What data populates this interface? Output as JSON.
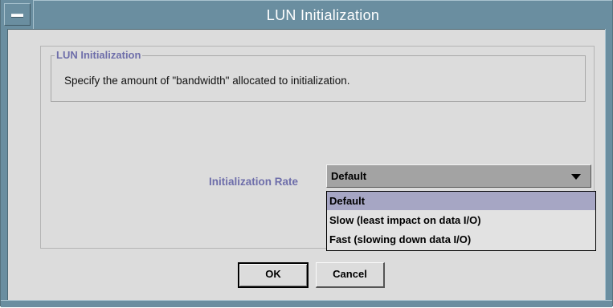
{
  "window": {
    "title": "LUN Initialization"
  },
  "group": {
    "title": "LUN Initialization",
    "description": "Specify the amount of \"bandwidth\" allocated to initialization."
  },
  "rate": {
    "label": "Initialization Rate",
    "selected": "Default",
    "options": [
      "Default",
      "Slow (least impact on data I/O)",
      "Fast (slowing down data I/O)"
    ]
  },
  "buttons": {
    "ok": "OK",
    "cancel": "Cancel"
  },
  "colors": {
    "titlebar": "#6a8ea0",
    "label_accent": "#6e6eaa",
    "selection": "#a6a6c4"
  }
}
